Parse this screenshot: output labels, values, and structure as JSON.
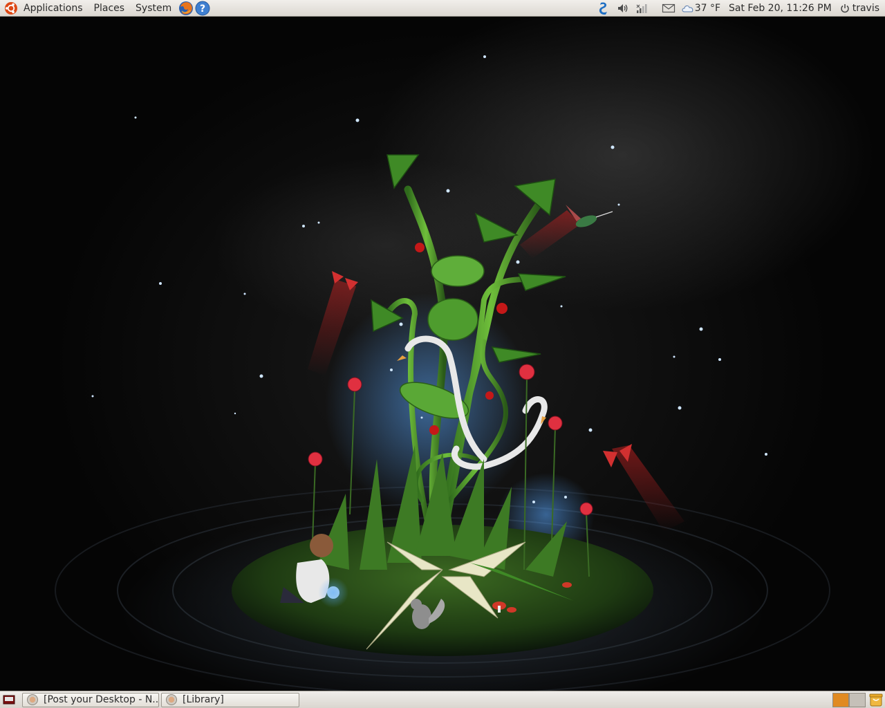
{
  "top_panel": {
    "menus": [
      "Applications",
      "Places",
      "System"
    ],
    "launchers": [
      "firefox-icon",
      "help-icon"
    ],
    "tray_icons": [
      "skype-icon",
      "volume-icon",
      "network-icon",
      "mail-icon"
    ],
    "weather": "37 °F",
    "clock": "Sat Feb 20, 11:26 PM",
    "user": "travis"
  },
  "desktop": {
    "wallpaper": "plant-fantasy-wallpaper"
  },
  "bottom_panel": {
    "tasks": [
      {
        "label": "[Post your Desktop - N...",
        "icon": "firefox-icon"
      },
      {
        "label": "[Library]",
        "icon": "firefox-icon"
      }
    ],
    "workspaces": [
      {
        "active": true
      },
      {
        "active": false
      }
    ]
  },
  "colors": {
    "panel": "#dcd8d1",
    "accent": "#e08a22"
  }
}
